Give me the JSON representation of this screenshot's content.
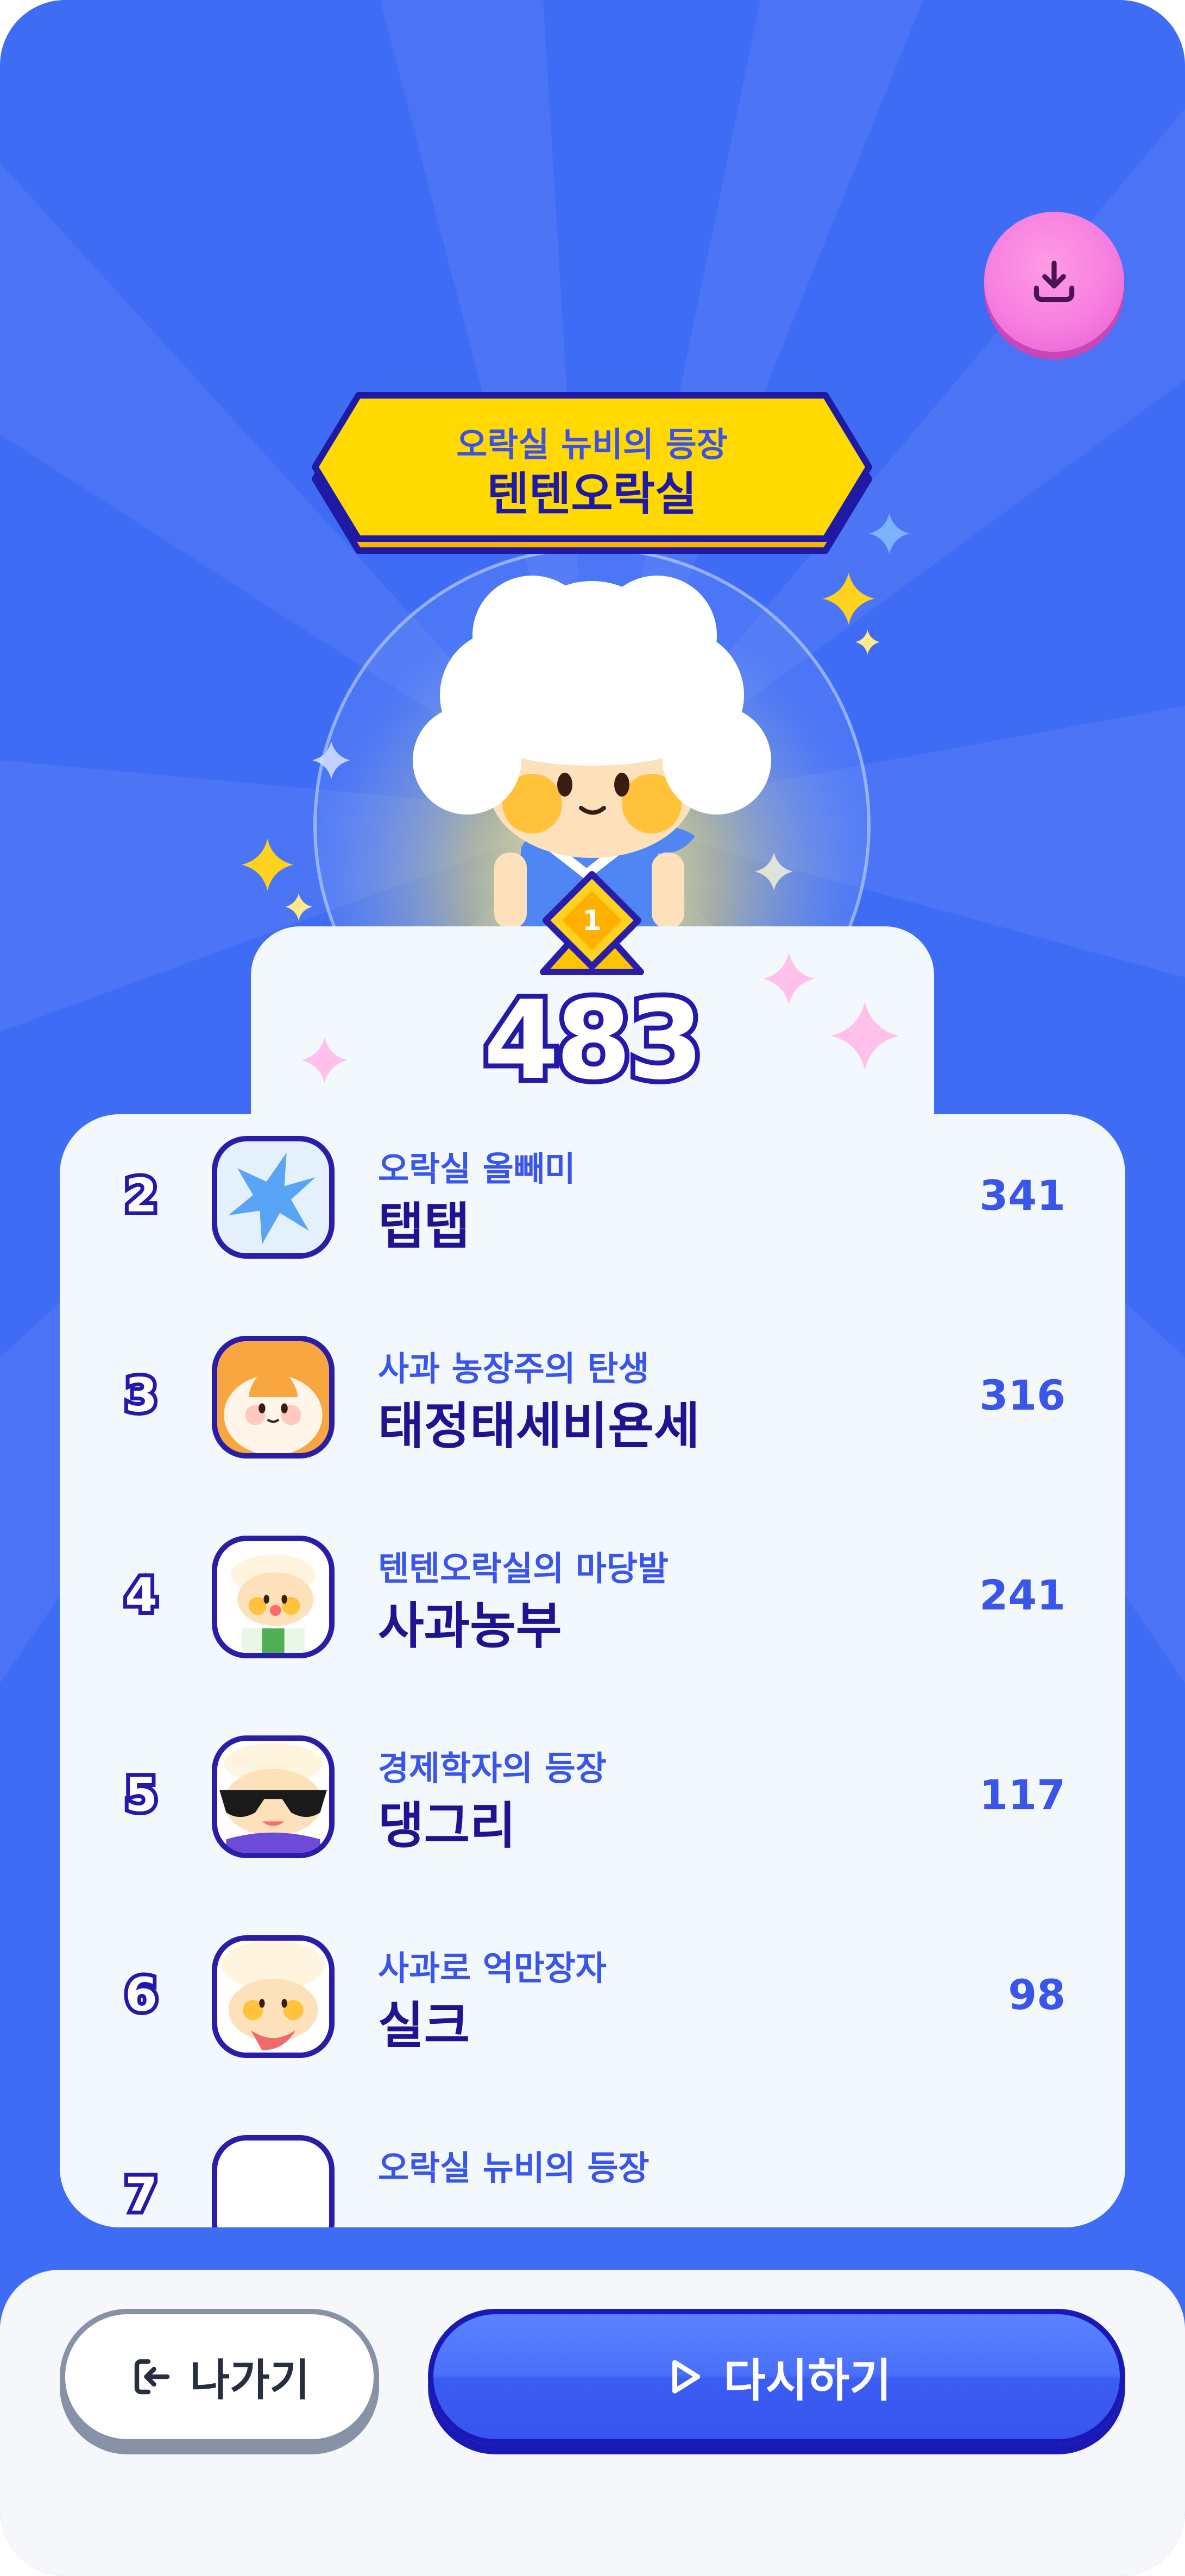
{
  "header": {
    "download_icon": "download-icon"
  },
  "winner": {
    "subtitle": "오락실 뉴비의 등장",
    "name": "텐텐오락실",
    "rank": "1",
    "score": "483"
  },
  "leaderboard": [
    {
      "rank": "2",
      "subtitle": "오락실 올빼미",
      "name": "탭탭",
      "score": "341",
      "avatar": "blue-star-icon"
    },
    {
      "rank": "3",
      "subtitle": "사과 농장주의 탄생",
      "name": "태정태세비욘세",
      "score": "316",
      "avatar": "cat-avatar"
    },
    {
      "rank": "4",
      "subtitle": "텐텐오락실의 마당발",
      "name": "사과농부",
      "score": "241",
      "avatar": "farmer-avatar"
    },
    {
      "rank": "5",
      "subtitle": "경제학자의 등장",
      "name": "댕그리",
      "score": "117",
      "avatar": "sunglasses-avatar"
    },
    {
      "rank": "6",
      "subtitle": "사과로 억만장자",
      "name": "실크",
      "score": "98",
      "avatar": "silk-avatar"
    },
    {
      "rank": "7",
      "subtitle": "오락실 뉴비의 등장",
      "name": "",
      "score": "",
      "avatar": "partial-avatar"
    }
  ],
  "actions": {
    "exit_label": "나가기",
    "retry_label": "다시하기"
  },
  "colors": {
    "background": "#3f6cf5",
    "accent_yellow": "#ffd400",
    "accent_pink": "#f77ee0",
    "text_navy": "#1d1590",
    "text_blue": "#3a55ea"
  }
}
